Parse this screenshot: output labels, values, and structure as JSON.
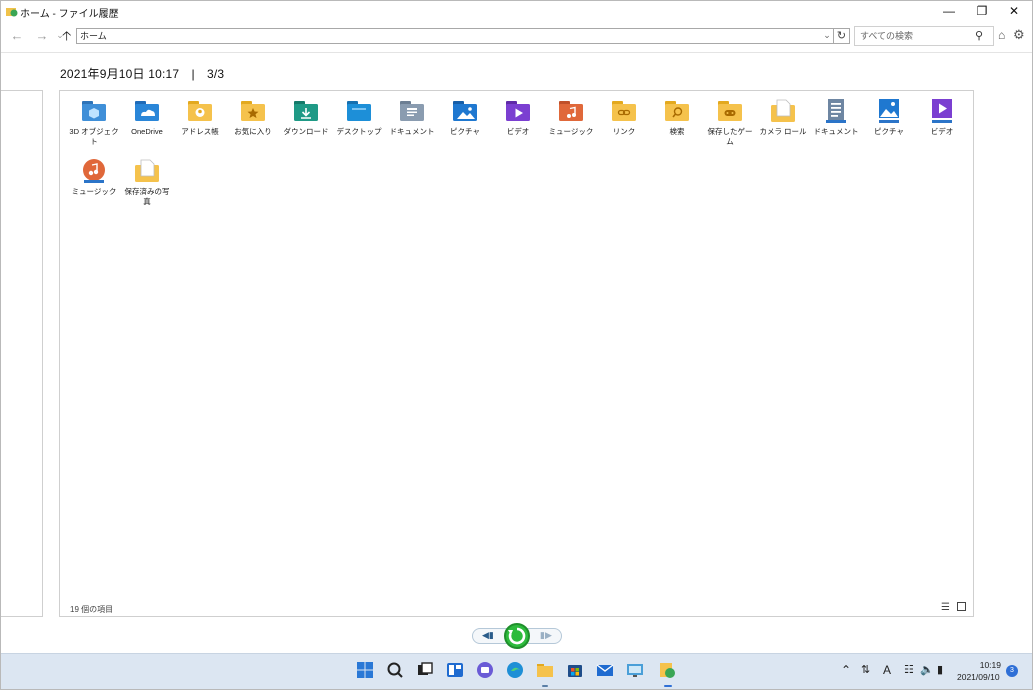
{
  "window": {
    "title": "ホーム - ファイル履歴",
    "minimize_icon": "minimize-icon",
    "restore_icon": "restore-icon",
    "close_icon": "close-icon"
  },
  "address_bar": {
    "path": "ホーム",
    "search_placeholder": "すべての検索"
  },
  "snapshot": {
    "label": "2021年9月10日 10:17　|　3/3"
  },
  "items": [
    {
      "label": "3D オブジェクト",
      "icon": "3d-objects-folder-icon"
    },
    {
      "label": "OneDrive",
      "icon": "onedrive-folder-icon"
    },
    {
      "label": "アドレス帳",
      "icon": "contacts-folder-icon"
    },
    {
      "label": "お気に入り",
      "icon": "favorites-folder-icon"
    },
    {
      "label": "ダウンロード",
      "icon": "downloads-folder-icon"
    },
    {
      "label": "デスクトップ",
      "icon": "desktop-folder-icon"
    },
    {
      "label": "ドキュメント",
      "icon": "documents-folder-icon"
    },
    {
      "label": "ピクチャ",
      "icon": "pictures-folder-icon"
    },
    {
      "label": "ビデオ",
      "icon": "videos-folder-icon"
    },
    {
      "label": "ミュージック",
      "icon": "music-folder-icon"
    },
    {
      "label": "リンク",
      "icon": "links-folder-icon"
    },
    {
      "label": "検索",
      "icon": "searches-folder-icon"
    },
    {
      "label": "保存したゲーム",
      "icon": "saved-games-folder-icon"
    },
    {
      "label": "カメラ ロール",
      "icon": "camera-roll-folder-icon"
    },
    {
      "label": "ドキュメント",
      "icon": "documents-library-icon"
    },
    {
      "label": "ピクチャ",
      "icon": "pictures-library-icon"
    },
    {
      "label": "ビデオ",
      "icon": "videos-library-icon"
    },
    {
      "label": "ミュージック",
      "icon": "music-library-icon"
    },
    {
      "label": "保存済みの写真",
      "icon": "saved-pictures-folder-icon"
    }
  ],
  "status": {
    "item_count": "19 個の項目"
  },
  "taskbar": {
    "time": "10:19",
    "date": "2021/09/10",
    "notification_count": "3",
    "ime": "A"
  },
  "colors": {
    "accent": "#2f6fd6",
    "restore_green": "#2dbb3c",
    "taskbar": "#dce6f2",
    "folder_yellow": "#f5c24c"
  }
}
